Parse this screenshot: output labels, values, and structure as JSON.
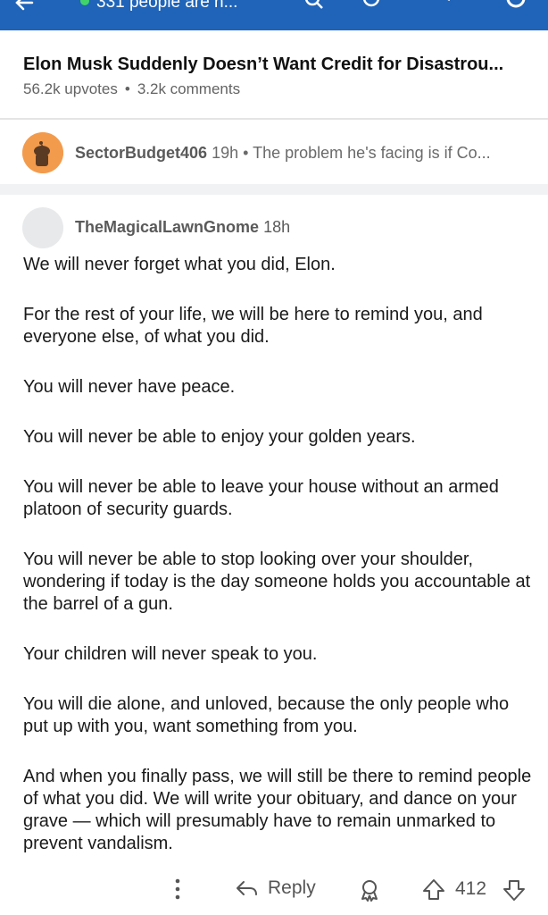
{
  "topbar": {
    "online_text": "331 people are n...",
    "accent": "#1f64b8",
    "online_color": "#41d36a",
    "icons": [
      "back-arrow-icon",
      "search-icon",
      "sort-icon",
      "share-icon",
      "profile-icon"
    ]
  },
  "post": {
    "title": "Elon Musk Suddenly Doesn’t Want Credit for Disastrou...",
    "upvotes": "56.2k upvotes",
    "separator": "•",
    "comments": "3.2k comments"
  },
  "parent_comment": {
    "username": "SectorBudget406",
    "time": "19h",
    "separator": "•",
    "preview": "The problem he's facing is if Co..."
  },
  "comment": {
    "username": "TheMagicalLawnGnome",
    "time": "18h",
    "paragraphs": [
      "We will never forget what you did, Elon.",
      "For the rest of your life, we will be here to remind you, and everyone else, of what you did.",
      "You will never have peace.",
      "You will never be able to enjoy your golden years.",
      "You will never be able to leave your house without an armed platoon of security guards.",
      "You will never be able to stop looking over your shoulder, wondering if today is the day someone holds you accountable at the barrel of a gun.",
      "Your children will never speak to you.",
      "You will die alone, and unloved, because the only people who put up with you, want something from you.",
      "And when you finally pass, we will still be there to remind people of what you did. We will write your obituary, and dance on your grave — which will presumably have to remain unmarked to prevent vandalism."
    ]
  },
  "actions": {
    "reply_label": "Reply",
    "vote_count": "412"
  }
}
